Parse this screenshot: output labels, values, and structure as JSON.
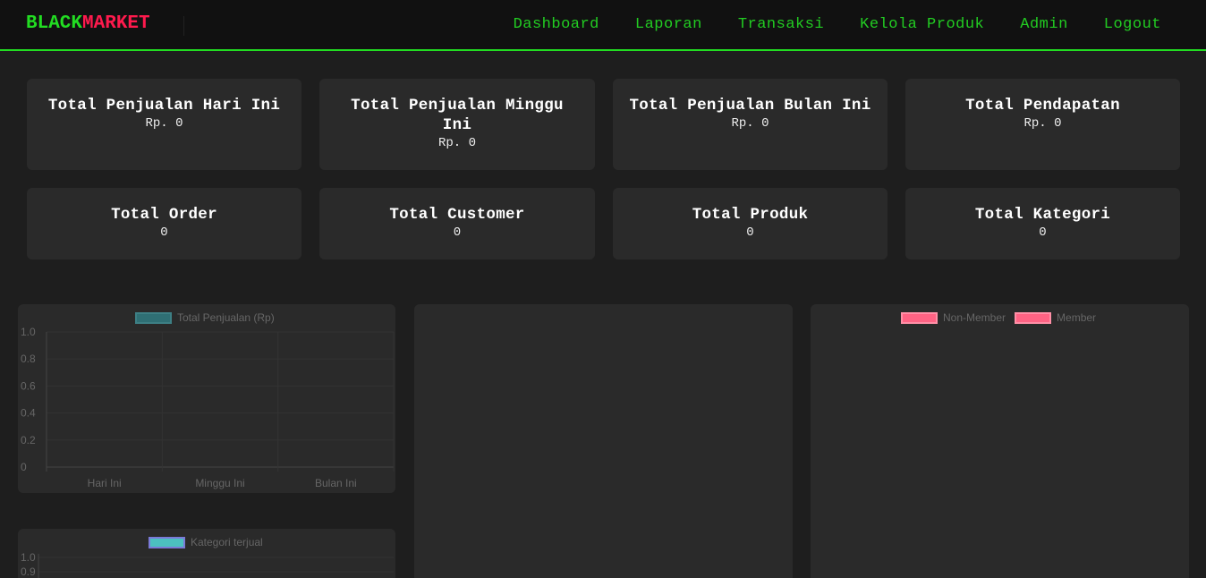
{
  "brand": {
    "part1": "BLACK",
    "part2": "MARKET"
  },
  "nav": {
    "dashboard": "Dashboard",
    "laporan": "Laporan",
    "transaksi": "Transaksi",
    "kelola_produk": "Kelola Produk",
    "admin": "Admin",
    "logout": "Logout"
  },
  "cards": [
    {
      "title": "Total Penjualan Hari Ini",
      "value": "Rp. 0"
    },
    {
      "title": "Total Penjualan Minggu Ini",
      "value": "Rp. 0"
    },
    {
      "title": "Total Penjualan Bulan Ini",
      "value": "Rp. 0"
    },
    {
      "title": "Total Pendapatan",
      "value": "Rp. 0"
    },
    {
      "title": "Total Order",
      "value": "0"
    },
    {
      "title": "Total Customer",
      "value": "0"
    },
    {
      "title": "Total Produk",
      "value": "0"
    },
    {
      "title": "Total Kategori",
      "value": "0"
    }
  ],
  "colors": {
    "brand_green": "#22dd22",
    "brand_red": "#ff1a4d",
    "nav_green": "#22cc22",
    "sales_series": "#2f6f74",
    "category_series": "#4cc0c0",
    "member_series": "#ff6384"
  },
  "chart_data": [
    {
      "type": "bar",
      "categories": [
        "Hari Ini",
        "Minggu Ini",
        "Bulan Ini"
      ],
      "series": [
        {
          "name": "Total Penjualan (Rp)",
          "values": [
            0,
            0,
            0
          ]
        }
      ],
      "ylim": [
        0,
        1.0
      ],
      "yticks": [
        "1.0",
        "0.8",
        "0.6",
        "0.4",
        "0.2",
        "0"
      ],
      "legend": "top-center",
      "grid": true
    },
    {
      "type": "bar",
      "categories": [],
      "series": [
        {
          "name": "Kategori terjual",
          "values": []
        }
      ],
      "yticks": [
        "1.0",
        "0.9"
      ],
      "legend": "top-center",
      "grid": true
    },
    {
      "type": "pie",
      "categories": [
        "Non-Member",
        "Member"
      ],
      "series": [
        {
          "name": "",
          "values": [
            0,
            0
          ]
        }
      ],
      "legend": "top-center"
    }
  ]
}
